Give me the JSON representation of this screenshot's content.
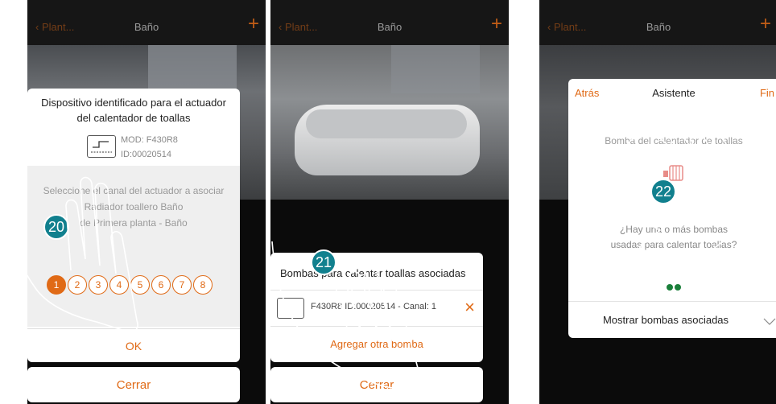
{
  "screen1": {
    "topbar": {
      "back": "Plant...",
      "title": "Baño",
      "plus": "+"
    },
    "dialog": {
      "heading": "Dispositivo identificado para el actuador del calentador de toallas",
      "model": "MOD: F430R8",
      "device_id": "ID:00020514",
      "instruction": "Seleccione el canal del actuador a asociar",
      "device_name": "Radiador toallero Baño",
      "location": "de Primera planta - Baño",
      "channels": [
        "1",
        "2",
        "3",
        "4",
        "5",
        "6",
        "7",
        "8"
      ],
      "selected_channel": "1",
      "ok_label": "OK"
    },
    "close_label": "Cerrar",
    "step": "20"
  },
  "screen2": {
    "topbar": {
      "back": "Plant...",
      "title": "Baño",
      "plus": "+"
    },
    "dialog": {
      "heading": "Bombas para calentar toallas asociadas",
      "item_text": "F430R8 ID:00020514 - Canal: 1",
      "remove_icon": "×",
      "add_label": "Agregar otra bomba"
    },
    "close_label": "Cerrar",
    "step": "21"
  },
  "screen3": {
    "topbar": {
      "back": "Plant...",
      "title": "Baño",
      "plus": "+"
    },
    "wizard": {
      "back_label": "Atrás",
      "title": "Asistente",
      "finish_label": "Fin",
      "subtitle": "Bomba del calentador de toallas",
      "question": "¿Hay una o más bombas usadas para calentar toallas?",
      "show_label": "Mostrar bombas asociadas",
      "page_count": 2
    },
    "step": "22"
  },
  "colors": {
    "accent": "#e06a16",
    "badge": "#11808e",
    "grey_text": "#9a9a9a"
  }
}
